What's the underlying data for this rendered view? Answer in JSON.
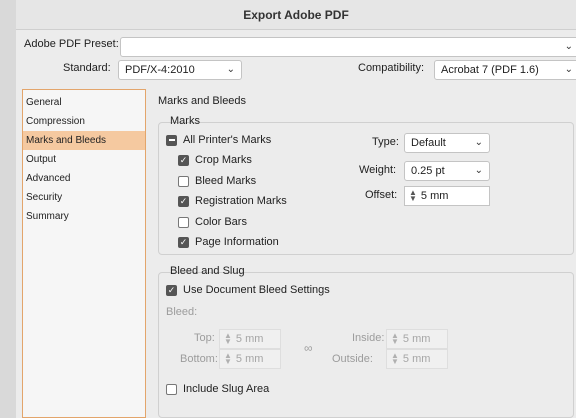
{
  "window": {
    "title": "Export Adobe PDF"
  },
  "preset": {
    "label": "Adobe PDF Preset:",
    "value": ""
  },
  "standard": {
    "label": "Standard:",
    "value": "PDF/X-4:2010"
  },
  "compatibility": {
    "label": "Compatibility:",
    "value": "Acrobat 7 (PDF 1.6)"
  },
  "sidebar": {
    "items": [
      {
        "label": "General"
      },
      {
        "label": "Compression"
      },
      {
        "label": "Marks and Bleeds"
      },
      {
        "label": "Output"
      },
      {
        "label": "Advanced"
      },
      {
        "label": "Security"
      },
      {
        "label": "Summary"
      }
    ],
    "selected": "Marks and Bleeds"
  },
  "panel": {
    "title": "Marks and Bleeds"
  },
  "marks": {
    "group_label": "Marks",
    "all_printers_marks": {
      "label": "All Printer's Marks",
      "state": "mixed"
    },
    "crop_marks": {
      "label": "Crop Marks",
      "checked": true
    },
    "bleed_marks": {
      "label": "Bleed Marks",
      "checked": false
    },
    "registration_marks": {
      "label": "Registration Marks",
      "checked": true
    },
    "color_bars": {
      "label": "Color Bars",
      "checked": false
    },
    "page_information": {
      "label": "Page Information",
      "checked": true
    },
    "type": {
      "label": "Type:",
      "value": "Default"
    },
    "weight": {
      "label": "Weight:",
      "value": "0.25 pt"
    },
    "offset": {
      "label": "Offset:",
      "value": "5 mm"
    }
  },
  "bleed": {
    "group_label": "Bleed and Slug",
    "use_document": {
      "label": "Use Document Bleed Settings",
      "checked": true
    },
    "bleed_label": "Bleed:",
    "top": {
      "label": "Top:",
      "value": "5 mm"
    },
    "bottom": {
      "label": "Bottom:",
      "value": "5 mm"
    },
    "inside": {
      "label": "Inside:",
      "value": "5 mm"
    },
    "outside": {
      "label": "Outside:",
      "value": "5 mm"
    },
    "include_slug": {
      "label": "Include Slug Area",
      "checked": false
    }
  },
  "icons": {
    "chevron": "chevron-down-icon",
    "stepper": "stepper-icon",
    "link": "chain-link-icon",
    "checkmark": "checkmark-icon"
  }
}
